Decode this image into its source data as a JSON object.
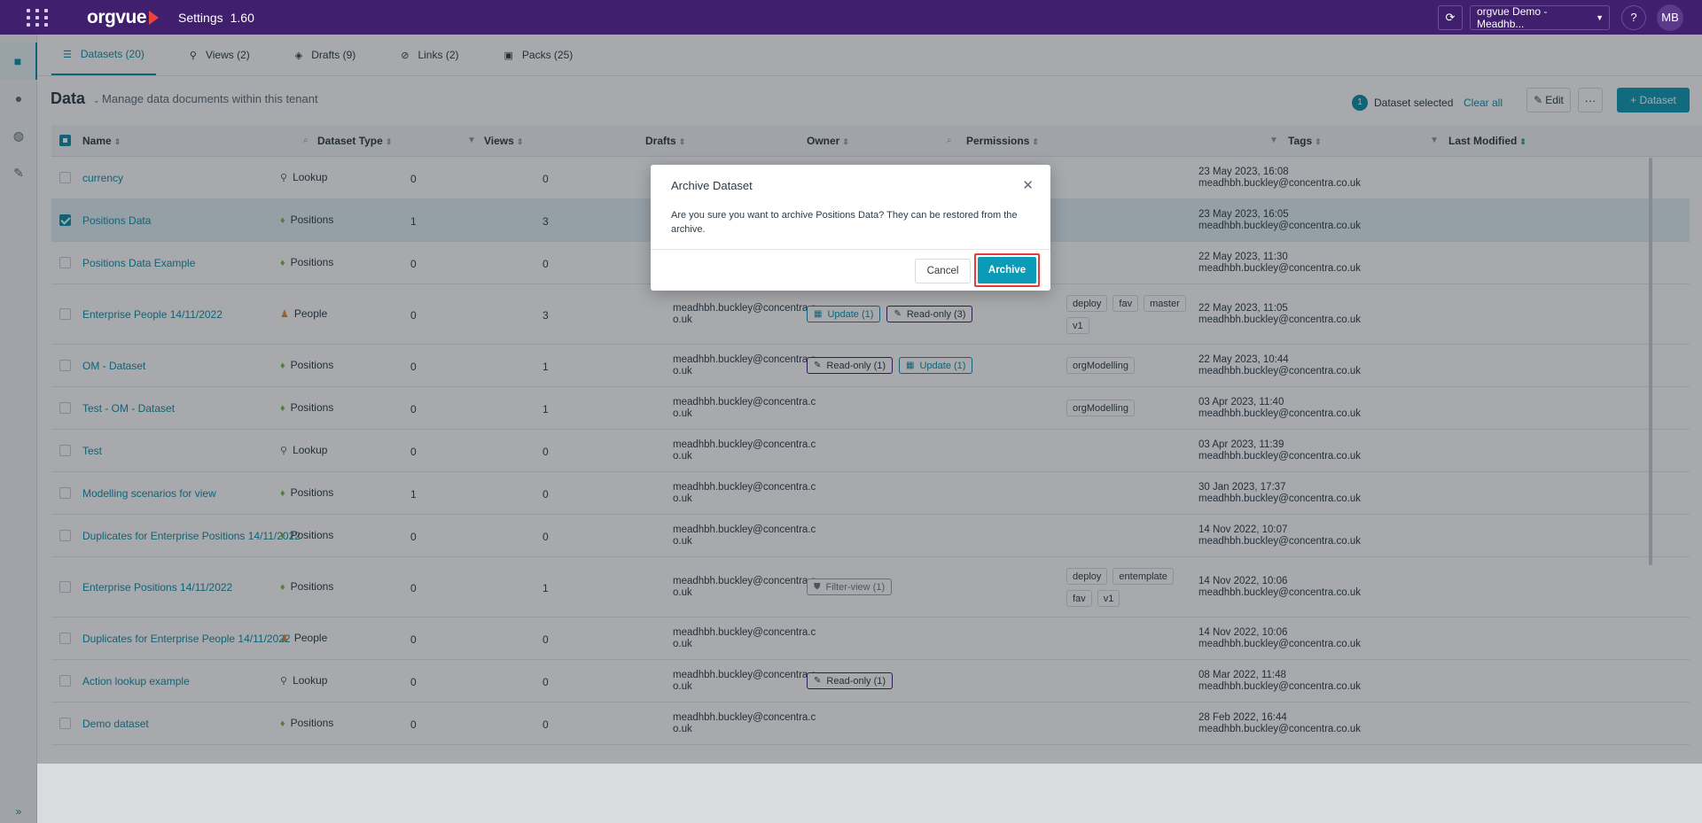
{
  "app": {
    "logo": "orgvue",
    "title": "Settings",
    "version": "1.60"
  },
  "topbar": {
    "tenant": "orgvue Demo - Meadhb...",
    "help_label": "?",
    "avatar_initials": "MB"
  },
  "tabs": [
    {
      "label": "Datasets (20)"
    },
    {
      "label": "Views (2)"
    },
    {
      "label": "Drafts (9)"
    },
    {
      "label": "Links (2)"
    },
    {
      "label": "Packs (25)"
    }
  ],
  "toolbar": {
    "title": "Data",
    "subtitle": "Manage data documents within this tenant",
    "selected_count": "1",
    "selected_text": "Dataset selected",
    "clear_all": "Clear all",
    "edit_label": "Edit",
    "add_label": "+ Dataset"
  },
  "columns": {
    "name": "Name",
    "type": "Dataset Type",
    "views": "Views",
    "drafts": "Drafts",
    "owner": "Owner",
    "permissions": "Permissions",
    "tags": "Tags",
    "modified": "Last Modified"
  },
  "rows": [
    {
      "name": "currency",
      "type": "Lookup",
      "views": "0",
      "drafts": "0",
      "owner": [
        "",
        ""
      ],
      "perms": [],
      "tags": [],
      "modified": [
        "23 May 2023, 16:08",
        "meadhbh.buckley@concentra.co.uk"
      ]
    },
    {
      "name": "Positions Data",
      "type": "Positions",
      "views": "1",
      "drafts": "3",
      "owner": [
        "",
        ""
      ],
      "perms": [],
      "tags": [],
      "modified": [
        "23 May 2023, 16:05",
        "meadhbh.buckley@concentra.co.uk"
      ]
    },
    {
      "name": "Positions Data Example",
      "type": "Positions",
      "views": "0",
      "drafts": "0",
      "owner": [
        "",
        ""
      ],
      "perms": [],
      "tags": [],
      "modified": [
        "22 May 2023, 11:30",
        "meadhbh.buckley@concentra.co.uk"
      ]
    },
    {
      "name": "Enterprise People 14/11/2022",
      "type": "People",
      "views": "0",
      "drafts": "3",
      "owner": [
        "meadhbh.buckley@concentra.c",
        "o.uk"
      ],
      "perms": [
        {
          "label": "Update (1)"
        },
        {
          "label": "Read-only (3)"
        }
      ],
      "tags": [
        {
          "label": "deploy"
        },
        {
          "label": "fav"
        },
        {
          "label": "master"
        },
        {
          "label": "v1"
        }
      ],
      "modified": [
        "22 May 2023, 11:05",
        "meadhbh.buckley@concentra.co.uk"
      ]
    },
    {
      "name": "OM - Dataset",
      "type": "Positions",
      "views": "0",
      "drafts": "1",
      "owner": [
        "meadhbh.buckley@concentra.c",
        "o.uk"
      ],
      "perms": [
        {
          "label": "Read-only (1)"
        },
        {
          "label": "Update (1)"
        }
      ],
      "tags": [
        {
          "label": "orgModelling"
        }
      ],
      "modified": [
        "22 May 2023, 10:44",
        "meadhbh.buckley@concentra.co.uk"
      ]
    },
    {
      "name": "Test - OM - Dataset",
      "type": "Positions",
      "views": "0",
      "drafts": "1",
      "owner": [
        "meadhbh.buckley@concentra.c",
        "o.uk"
      ],
      "perms": [],
      "tags": [
        {
          "label": "orgModelling"
        }
      ],
      "modified": [
        "03 Apr 2023, 11:40",
        "meadhbh.buckley@concentra.co.uk"
      ]
    },
    {
      "name": "Test",
      "type": "Lookup",
      "views": "0",
      "drafts": "0",
      "owner": [
        "meadhbh.buckley@concentra.c",
        "o.uk"
      ],
      "perms": [],
      "tags": [],
      "modified": [
        "03 Apr 2023, 11:39",
        "meadhbh.buckley@concentra.co.uk"
      ]
    },
    {
      "name": "Modelling scenarios for view",
      "type": "Positions",
      "views": "1",
      "drafts": "0",
      "owner": [
        "meadhbh.buckley@concentra.c",
        "o.uk"
      ],
      "perms": [],
      "tags": [],
      "modified": [
        "30 Jan 2023, 17:37",
        "meadhbh.buckley@concentra.co.uk"
      ]
    },
    {
      "name": "Duplicates for Enterprise Positions 14/11/2022",
      "type": "Positions",
      "views": "0",
      "drafts": "0",
      "owner": [
        "meadhbh.buckley@concentra.c",
        "o.uk"
      ],
      "perms": [],
      "tags": [],
      "modified": [
        "14 Nov 2022, 10:07",
        "meadhbh.buckley@concentra.co.uk"
      ]
    },
    {
      "name": "Enterprise Positions 14/11/2022",
      "type": "Positions",
      "views": "0",
      "drafts": "1",
      "owner": [
        "meadhbh.buckley@concentra.c",
        "o.uk"
      ],
      "perms": [
        {
          "label": "Filter-view (1)"
        }
      ],
      "tags": [
        {
          "label": "deploy"
        },
        {
          "label": "entemplate"
        },
        {
          "label": "fav"
        },
        {
          "label": "v1"
        }
      ],
      "modified": [
        "14 Nov 2022, 10:06",
        "meadhbh.buckley@concentra.co.uk"
      ]
    },
    {
      "name": "Duplicates for Enterprise People 14/11/2022",
      "type": "People",
      "views": "0",
      "drafts": "0",
      "owner": [
        "meadhbh.buckley@concentra.c",
        "o.uk"
      ],
      "perms": [],
      "tags": [],
      "modified": [
        "14 Nov 2022, 10:06",
        "meadhbh.buckley@concentra.co.uk"
      ]
    },
    {
      "name": "Action lookup example",
      "type": "Lookup",
      "views": "0",
      "drafts": "0",
      "owner": [
        "meadhbh.buckley@concentra.c",
        "o.uk"
      ],
      "perms": [
        {
          "label": "Read-only (1)"
        }
      ],
      "tags": [],
      "modified": [
        "08 Mar 2022, 11:48",
        "meadhbh.buckley@concentra.co.uk"
      ]
    },
    {
      "name": "Demo dataset",
      "type": "Positions",
      "views": "0",
      "drafts": "0",
      "owner": [
        "meadhbh.buckley@concentra.c",
        "o.uk"
      ],
      "perms": [],
      "tags": [],
      "modified": [
        "28 Feb 2022, 16:44",
        "meadhbh.buckley@concentra.co.uk"
      ]
    }
  ],
  "modal": {
    "title": "Archive Dataset",
    "body": "Are you sure you want to archive Positions Data? They can be restored from the archive.",
    "cancel_label": "Cancel",
    "archive_label": "Archive"
  },
  "colors": {
    "topbar": "#3f1f6e",
    "accent": "#0c9bb6",
    "highlight": "#e53b3b"
  }
}
